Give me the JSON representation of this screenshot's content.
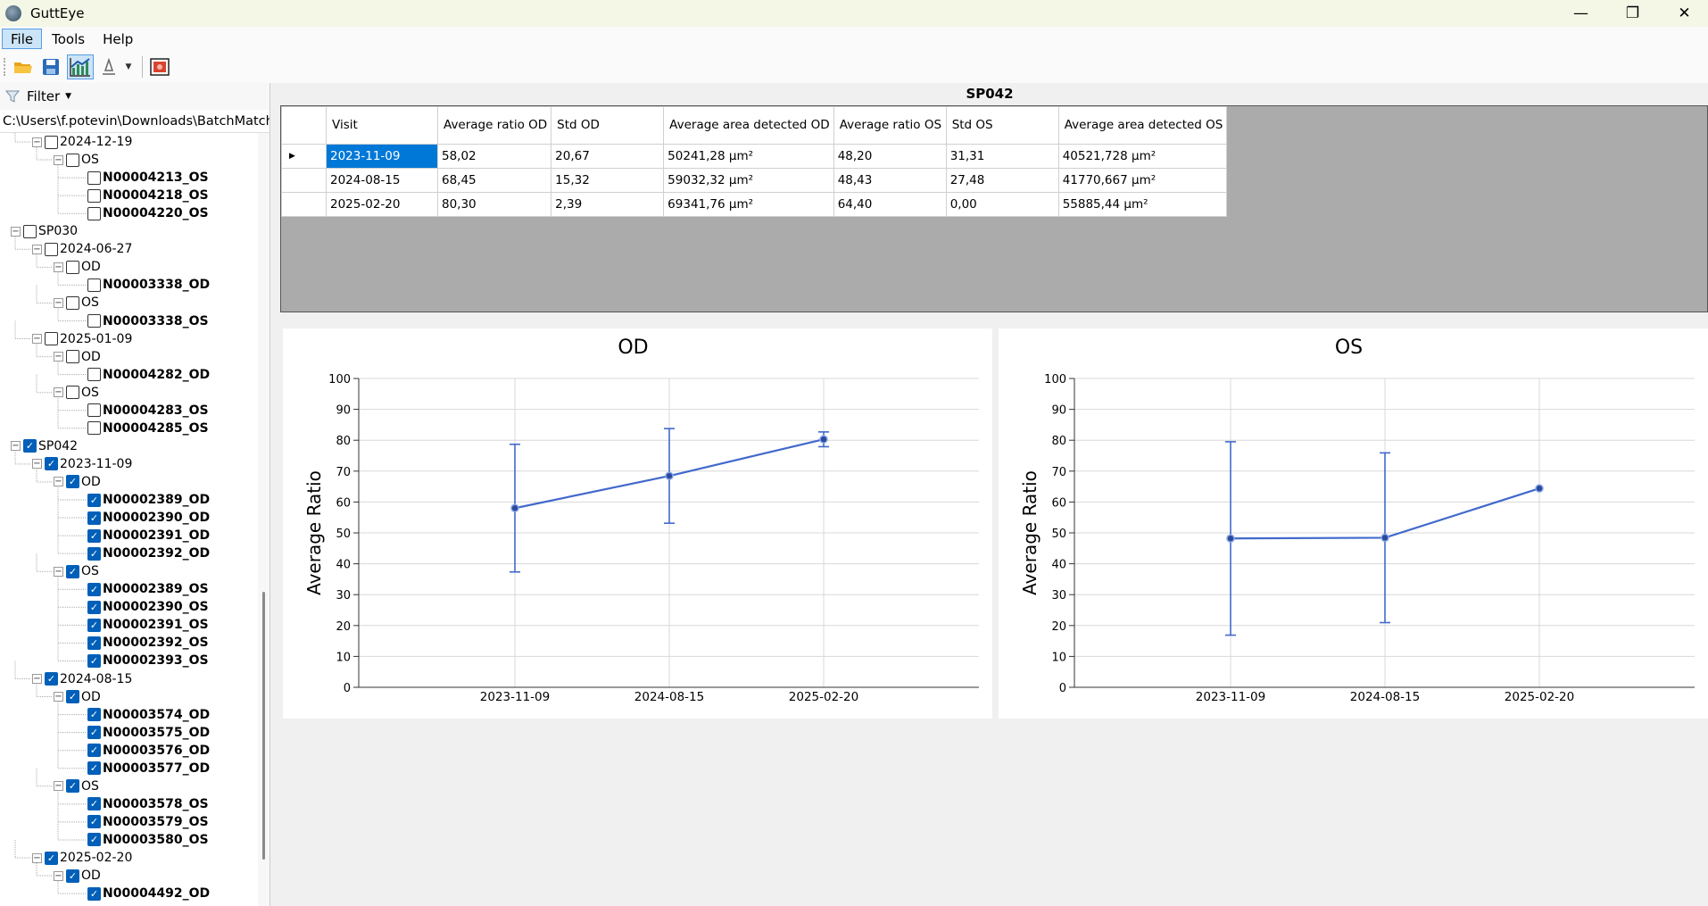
{
  "window": {
    "title": "GuttEye",
    "minimize": "—",
    "restore": "❐",
    "close": "✕"
  },
  "menu": {
    "file": "File",
    "tools": "Tools",
    "help": "Help"
  },
  "toolbar_icons": [
    "open-folder-icon",
    "save-icon",
    "chart-icon",
    "export-icon",
    "image-icon"
  ],
  "left": {
    "filter_label": "Filter",
    "path": "C:\\Users\\f.potevin\\Downloads\\BatchMatching",
    "tree": [
      {
        "label": "2024-12-19",
        "level": 1,
        "exp": "⊟",
        "checked": false
      },
      {
        "label": "OS",
        "level": 2,
        "exp": "⊟",
        "checked": false
      },
      {
        "label": "N00004213_OS",
        "level": 3,
        "checked": false,
        "leaf": true
      },
      {
        "label": "N00004218_OS",
        "level": 3,
        "checked": false,
        "leaf": true
      },
      {
        "label": "N00004220_OS",
        "level": 3,
        "checked": false,
        "leaf": true
      },
      {
        "label": "SP030",
        "level": 0,
        "exp": "⊟",
        "checked": false
      },
      {
        "label": "2024-06-27",
        "level": 1,
        "exp": "⊟",
        "checked": false
      },
      {
        "label": "OD",
        "level": 2,
        "exp": "⊟",
        "checked": false
      },
      {
        "label": "N00003338_OD",
        "level": 3,
        "checked": false,
        "leaf": true
      },
      {
        "label": "OS",
        "level": 2,
        "exp": "⊟",
        "checked": false
      },
      {
        "label": "N00003338_OS",
        "level": 3,
        "checked": false,
        "leaf": true
      },
      {
        "label": "2025-01-09",
        "level": 1,
        "exp": "⊟",
        "checked": false
      },
      {
        "label": "OD",
        "level": 2,
        "exp": "⊟",
        "checked": false
      },
      {
        "label": "N00004282_OD",
        "level": 3,
        "checked": false,
        "leaf": true
      },
      {
        "label": "OS",
        "level": 2,
        "exp": "⊟",
        "checked": false
      },
      {
        "label": "N00004283_OS",
        "level": 3,
        "checked": false,
        "leaf": true
      },
      {
        "label": "N00004285_OS",
        "level": 3,
        "checked": false,
        "leaf": true
      },
      {
        "label": "SP042",
        "level": 0,
        "exp": "⊟",
        "checked": true
      },
      {
        "label": "2023-11-09",
        "level": 1,
        "exp": "⊟",
        "checked": true
      },
      {
        "label": "OD",
        "level": 2,
        "exp": "⊟",
        "checked": true
      },
      {
        "label": "N00002389_OD",
        "level": 3,
        "checked": true,
        "leaf": true
      },
      {
        "label": "N00002390_OD",
        "level": 3,
        "checked": true,
        "leaf": true
      },
      {
        "label": "N00002391_OD",
        "level": 3,
        "checked": true,
        "leaf": true
      },
      {
        "label": "N00002392_OD",
        "level": 3,
        "checked": true,
        "leaf": true
      },
      {
        "label": "OS",
        "level": 2,
        "exp": "⊟",
        "checked": true
      },
      {
        "label": "N00002389_OS",
        "level": 3,
        "checked": true,
        "leaf": true
      },
      {
        "label": "N00002390_OS",
        "level": 3,
        "checked": true,
        "leaf": true
      },
      {
        "label": "N00002391_OS",
        "level": 3,
        "checked": true,
        "leaf": true
      },
      {
        "label": "N00002392_OS",
        "level": 3,
        "checked": true,
        "leaf": true
      },
      {
        "label": "N00002393_OS",
        "level": 3,
        "checked": true,
        "leaf": true
      },
      {
        "label": "2024-08-15",
        "level": 1,
        "exp": "⊟",
        "checked": true
      },
      {
        "label": "OD",
        "level": 2,
        "exp": "⊟",
        "checked": true
      },
      {
        "label": "N00003574_OD",
        "level": 3,
        "checked": true,
        "leaf": true
      },
      {
        "label": "N00003575_OD",
        "level": 3,
        "checked": true,
        "leaf": true
      },
      {
        "label": "N00003576_OD",
        "level": 3,
        "checked": true,
        "leaf": true
      },
      {
        "label": "N00003577_OD",
        "level": 3,
        "checked": true,
        "leaf": true
      },
      {
        "label": "OS",
        "level": 2,
        "exp": "⊟",
        "checked": true
      },
      {
        "label": "N00003578_OS",
        "level": 3,
        "checked": true,
        "leaf": true
      },
      {
        "label": "N00003579_OS",
        "level": 3,
        "checked": true,
        "leaf": true
      },
      {
        "label": "N00003580_OS",
        "level": 3,
        "checked": true,
        "leaf": true
      },
      {
        "label": "2025-02-20",
        "level": 1,
        "exp": "⊟",
        "checked": true
      },
      {
        "label": "OD",
        "level": 2,
        "exp": "⊟",
        "checked": true
      },
      {
        "label": "N00004492_OD",
        "level": 3,
        "checked": true,
        "leaf": true
      }
    ]
  },
  "grid": {
    "title": "SP042",
    "columns": [
      "Visit",
      "Average ratio OD",
      "Std OD",
      "Average area detected OD",
      "Average ratio OS",
      "Std OS",
      "Average area detected OS"
    ],
    "rows": [
      [
        "2023-11-09",
        "58,02",
        "20,67",
        "50241,28 µm²",
        "48,20",
        "31,31",
        "40521,728 µm²"
      ],
      [
        "2024-08-15",
        "68,45",
        "15,32",
        "59032,32 µm²",
        "48,43",
        "27,48",
        "41770,667 µm²"
      ],
      [
        "2025-02-20",
        "80,30",
        "2,39",
        "69341,76 µm²",
        "64,40",
        "0,00",
        "55885,44 µm²"
      ]
    ],
    "row_marker": "▶"
  },
  "chart_data": [
    {
      "type": "line",
      "title": "OD",
      "ylabel": "Average Ratio",
      "xlabel": "",
      "categories": [
        "2023-11-09",
        "2024-08-15",
        "2025-02-20"
      ],
      "values": [
        58.02,
        68.45,
        80.3
      ],
      "error": [
        20.67,
        15.32,
        2.39
      ],
      "ylim": [
        0,
        100
      ],
      "yticks": [
        "0",
        "10",
        "20",
        "30",
        "40",
        "50",
        "60",
        "70",
        "80",
        "90",
        "100"
      ],
      "color": "#4169cc",
      "grid": true
    },
    {
      "type": "line",
      "title": "OS",
      "ylabel": "Average Ratio",
      "xlabel": "",
      "categories": [
        "2023-11-09",
        "2024-08-15",
        "2025-02-20"
      ],
      "values": [
        48.2,
        48.43,
        64.4
      ],
      "error": [
        31.31,
        27.48,
        0.0
      ],
      "ylim": [
        0,
        100
      ],
      "yticks": [
        "0",
        "10",
        "20",
        "30",
        "40",
        "50",
        "60",
        "70",
        "80",
        "90",
        "100"
      ],
      "color": "#4169cc",
      "grid": true
    }
  ]
}
